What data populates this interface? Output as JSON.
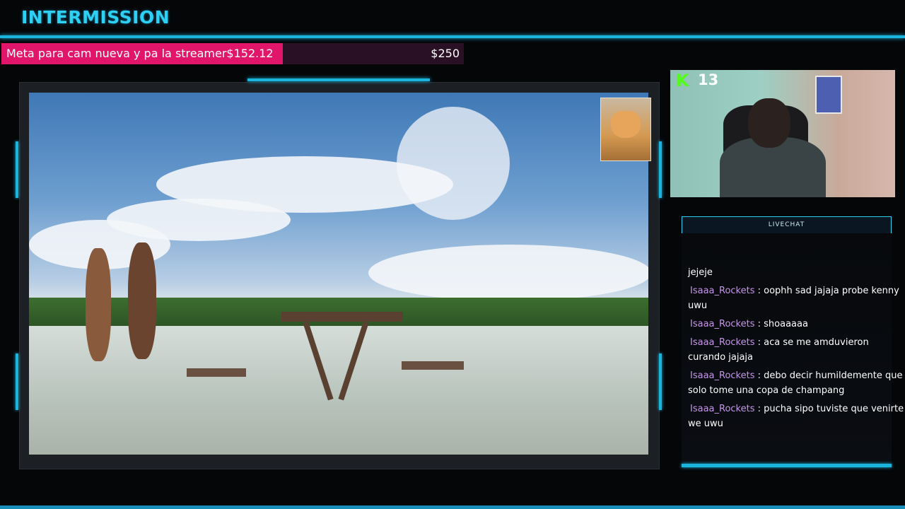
{
  "header": {
    "title": "INTERMISSION"
  },
  "goal": {
    "label": "Meta para cam nueva y pa la streamer$152.12",
    "target": "$250",
    "progress_fraction": 0.608,
    "fill_color": "#e1156a"
  },
  "stream": {
    "viewer_icon": "kick-icon",
    "viewer_count": "13"
  },
  "chat": {
    "header": "LIVECHAT",
    "messages": [
      {
        "user": "",
        "text": "jejeje"
      },
      {
        "user": "Isaaa_Rockets",
        "text": " : oophh sad jajaja probe kenny uwu"
      },
      {
        "user": "Isaaa_Rockets",
        "text": " : shoaaaaa"
      },
      {
        "user": "Isaaa_Rockets",
        "text": " : aca se me amduvieron curando jajaja"
      },
      {
        "user": "Isaaa_Rockets",
        "text": " : debo decir humildemente que solo tome una copa de champang"
      },
      {
        "user": "Isaaa_Rockets",
        "text": " : pucha sipo tuviste que venirte we uwu"
      }
    ]
  },
  "colors": {
    "accent": "#1ab4dc",
    "username": "#c596e8",
    "kick_green": "#53fc18"
  }
}
